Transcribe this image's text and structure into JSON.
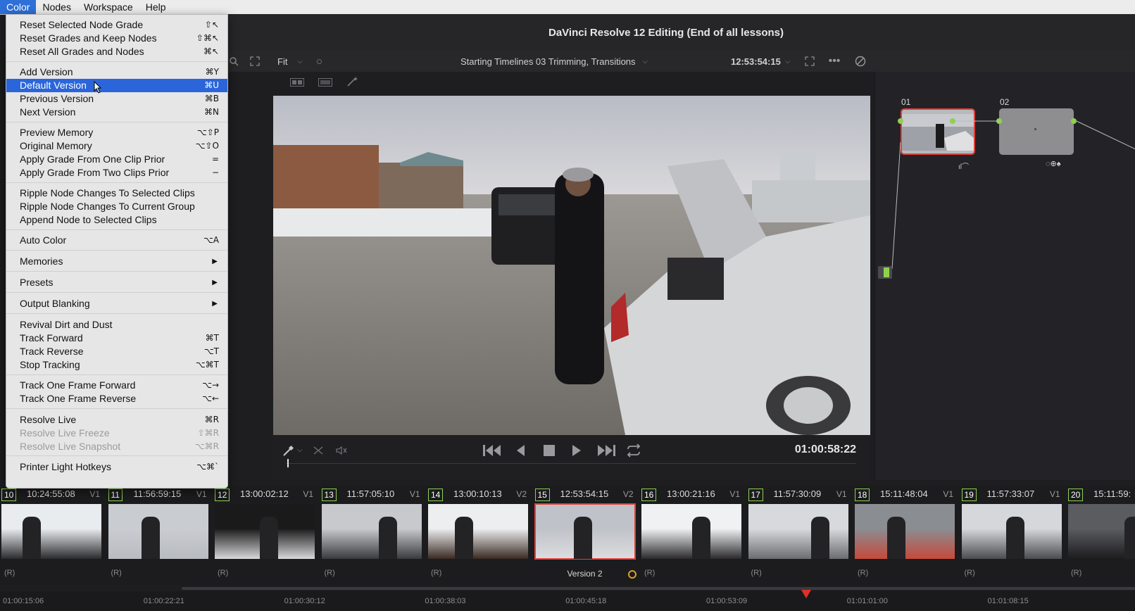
{
  "menubar": {
    "items": [
      "Color",
      "Nodes",
      "Workspace",
      "Help"
    ]
  },
  "window": {
    "title": "DaVinci Resolve 12 Editing (End of all lessons)"
  },
  "viewer_toolbar": {
    "fit_label": "Fit",
    "timeline_name": "Starting Timelines 03 Trimming, Transitions",
    "source_timecode": "12:53:54:15"
  },
  "transport": {
    "timecode": "01:00:58:22"
  },
  "nodes": [
    {
      "label": "01"
    },
    {
      "label": "02"
    }
  ],
  "color_menu": {
    "items": [
      {
        "label": "Reset Selected Node Grade",
        "shortcut": "⇧↖"
      },
      {
        "label": "Reset Grades and Keep Nodes",
        "shortcut": "⇧⌘↖"
      },
      {
        "label": "Reset All Grades and Nodes",
        "shortcut": "⌘↖"
      },
      {
        "label": "Add Version",
        "shortcut": "⌘Y"
      },
      {
        "label": "Default Version",
        "shortcut": "⌘U"
      },
      {
        "label": "Previous Version",
        "shortcut": "⌘B"
      },
      {
        "label": "Next Version",
        "shortcut": "⌘N"
      },
      {
        "label": "Preview Memory",
        "shortcut": "⌥⇧P"
      },
      {
        "label": "Original Memory",
        "shortcut": "⌥⇧O"
      },
      {
        "label": "Apply Grade From One Clip Prior",
        "shortcut": "="
      },
      {
        "label": "Apply Grade From Two Clips Prior",
        "shortcut": "−"
      },
      {
        "label": "Ripple Node Changes To Selected Clips",
        "shortcut": ""
      },
      {
        "label": "Ripple Node Changes To Current Group",
        "shortcut": ""
      },
      {
        "label": "Append Node to Selected Clips",
        "shortcut": ""
      },
      {
        "label": "Auto Color",
        "shortcut": "⌥A"
      },
      {
        "label": "Memories",
        "shortcut": "▶"
      },
      {
        "label": "Presets",
        "shortcut": "▶"
      },
      {
        "label": "Output Blanking",
        "shortcut": "▶"
      },
      {
        "label": "Revival Dirt and Dust",
        "shortcut": ""
      },
      {
        "label": "Track Forward",
        "shortcut": "⌘T"
      },
      {
        "label": "Track Reverse",
        "shortcut": "⌥T"
      },
      {
        "label": "Stop Tracking",
        "shortcut": "⌥⌘T"
      },
      {
        "label": "Track One Frame Forward",
        "shortcut": "⌥→"
      },
      {
        "label": "Track One Frame Reverse",
        "shortcut": "⌥←"
      },
      {
        "label": "Resolve Live",
        "shortcut": "⌘R"
      },
      {
        "label": "Resolve Live Freeze",
        "shortcut": "⇧⌘R"
      },
      {
        "label": "Resolve Live Snapshot",
        "shortcut": "⌥⌘R"
      },
      {
        "label": "Printer Light Hotkeys",
        "shortcut": "⌥⌘`"
      }
    ]
  },
  "clips": [
    {
      "num": "10",
      "tc": "10:24:55:08",
      "track": "V1",
      "tag": "(R)"
    },
    {
      "num": "11",
      "tc": "11:56:59:15",
      "track": "V1",
      "tag": "(R)"
    },
    {
      "num": "12",
      "tc": "13:00:02:12",
      "track": "V1",
      "tag": "(R)"
    },
    {
      "num": "13",
      "tc": "11:57:05:10",
      "track": "V1",
      "tag": "(R)"
    },
    {
      "num": "14",
      "tc": "13:00:10:13",
      "track": "V2",
      "tag": "(R)"
    },
    {
      "num": "15",
      "tc": "12:53:54:15",
      "track": "V2",
      "tag": "Version 2"
    },
    {
      "num": "16",
      "tc": "13:00:21:16",
      "track": "V1",
      "tag": "(R)"
    },
    {
      "num": "17",
      "tc": "11:57:30:09",
      "track": "V1",
      "tag": "(R)"
    },
    {
      "num": "18",
      "tc": "15:11:48:04",
      "track": "V1",
      "tag": "(R)"
    },
    {
      "num": "19",
      "tc": "11:57:33:07",
      "track": "V1",
      "tag": "(R)"
    },
    {
      "num": "20",
      "tc": "15:11:59:",
      "track": "",
      "tag": "(R)"
    }
  ],
  "ruler": [
    "01:00:15:06",
    "01:00:22:21",
    "01:00:30:12",
    "01:00:38:03",
    "01:00:45:18",
    "01:00:53:09",
    "01:01:01:00",
    "01:01:08:15"
  ]
}
